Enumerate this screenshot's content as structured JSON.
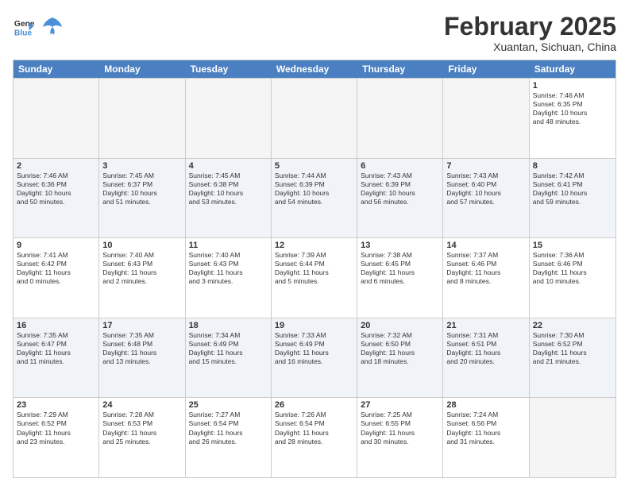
{
  "logo": {
    "line1": "General",
    "line2": "Blue"
  },
  "title": "February 2025",
  "subtitle": "Xuantan, Sichuan, China",
  "header_days": [
    "Sunday",
    "Monday",
    "Tuesday",
    "Wednesday",
    "Thursday",
    "Friday",
    "Saturday"
  ],
  "weeks": [
    {
      "alt": false,
      "cells": [
        {
          "day": "",
          "info": "",
          "empty": true
        },
        {
          "day": "",
          "info": "",
          "empty": true
        },
        {
          "day": "",
          "info": "",
          "empty": true
        },
        {
          "day": "",
          "info": "",
          "empty": true
        },
        {
          "day": "",
          "info": "",
          "empty": true
        },
        {
          "day": "",
          "info": "",
          "empty": true
        },
        {
          "day": "1",
          "info": "Sunrise: 7:46 AM\nSunset: 6:35 PM\nDaylight: 10 hours\nand 48 minutes.",
          "empty": false
        }
      ]
    },
    {
      "alt": true,
      "cells": [
        {
          "day": "2",
          "info": "Sunrise: 7:46 AM\nSunset: 6:36 PM\nDaylight: 10 hours\nand 50 minutes.",
          "empty": false
        },
        {
          "day": "3",
          "info": "Sunrise: 7:45 AM\nSunset: 6:37 PM\nDaylight: 10 hours\nand 51 minutes.",
          "empty": false
        },
        {
          "day": "4",
          "info": "Sunrise: 7:45 AM\nSunset: 6:38 PM\nDaylight: 10 hours\nand 53 minutes.",
          "empty": false
        },
        {
          "day": "5",
          "info": "Sunrise: 7:44 AM\nSunset: 6:39 PM\nDaylight: 10 hours\nand 54 minutes.",
          "empty": false
        },
        {
          "day": "6",
          "info": "Sunrise: 7:43 AM\nSunset: 6:39 PM\nDaylight: 10 hours\nand 56 minutes.",
          "empty": false
        },
        {
          "day": "7",
          "info": "Sunrise: 7:43 AM\nSunset: 6:40 PM\nDaylight: 10 hours\nand 57 minutes.",
          "empty": false
        },
        {
          "day": "8",
          "info": "Sunrise: 7:42 AM\nSunset: 6:41 PM\nDaylight: 10 hours\nand 59 minutes.",
          "empty": false
        }
      ]
    },
    {
      "alt": false,
      "cells": [
        {
          "day": "9",
          "info": "Sunrise: 7:41 AM\nSunset: 6:42 PM\nDaylight: 11 hours\nand 0 minutes.",
          "empty": false
        },
        {
          "day": "10",
          "info": "Sunrise: 7:40 AM\nSunset: 6:43 PM\nDaylight: 11 hours\nand 2 minutes.",
          "empty": false
        },
        {
          "day": "11",
          "info": "Sunrise: 7:40 AM\nSunset: 6:43 PM\nDaylight: 11 hours\nand 3 minutes.",
          "empty": false
        },
        {
          "day": "12",
          "info": "Sunrise: 7:39 AM\nSunset: 6:44 PM\nDaylight: 11 hours\nand 5 minutes.",
          "empty": false
        },
        {
          "day": "13",
          "info": "Sunrise: 7:38 AM\nSunset: 6:45 PM\nDaylight: 11 hours\nand 6 minutes.",
          "empty": false
        },
        {
          "day": "14",
          "info": "Sunrise: 7:37 AM\nSunset: 6:46 PM\nDaylight: 11 hours\nand 8 minutes.",
          "empty": false
        },
        {
          "day": "15",
          "info": "Sunrise: 7:36 AM\nSunset: 6:46 PM\nDaylight: 11 hours\nand 10 minutes.",
          "empty": false
        }
      ]
    },
    {
      "alt": true,
      "cells": [
        {
          "day": "16",
          "info": "Sunrise: 7:35 AM\nSunset: 6:47 PM\nDaylight: 11 hours\nand 11 minutes.",
          "empty": false
        },
        {
          "day": "17",
          "info": "Sunrise: 7:35 AM\nSunset: 6:48 PM\nDaylight: 11 hours\nand 13 minutes.",
          "empty": false
        },
        {
          "day": "18",
          "info": "Sunrise: 7:34 AM\nSunset: 6:49 PM\nDaylight: 11 hours\nand 15 minutes.",
          "empty": false
        },
        {
          "day": "19",
          "info": "Sunrise: 7:33 AM\nSunset: 6:49 PM\nDaylight: 11 hours\nand 16 minutes.",
          "empty": false
        },
        {
          "day": "20",
          "info": "Sunrise: 7:32 AM\nSunset: 6:50 PM\nDaylight: 11 hours\nand 18 minutes.",
          "empty": false
        },
        {
          "day": "21",
          "info": "Sunrise: 7:31 AM\nSunset: 6:51 PM\nDaylight: 11 hours\nand 20 minutes.",
          "empty": false
        },
        {
          "day": "22",
          "info": "Sunrise: 7:30 AM\nSunset: 6:52 PM\nDaylight: 11 hours\nand 21 minutes.",
          "empty": false
        }
      ]
    },
    {
      "alt": false,
      "cells": [
        {
          "day": "23",
          "info": "Sunrise: 7:29 AM\nSunset: 6:52 PM\nDaylight: 11 hours\nand 23 minutes.",
          "empty": false
        },
        {
          "day": "24",
          "info": "Sunrise: 7:28 AM\nSunset: 6:53 PM\nDaylight: 11 hours\nand 25 minutes.",
          "empty": false
        },
        {
          "day": "25",
          "info": "Sunrise: 7:27 AM\nSunset: 6:54 PM\nDaylight: 11 hours\nand 26 minutes.",
          "empty": false
        },
        {
          "day": "26",
          "info": "Sunrise: 7:26 AM\nSunset: 6:54 PM\nDaylight: 11 hours\nand 28 minutes.",
          "empty": false
        },
        {
          "day": "27",
          "info": "Sunrise: 7:25 AM\nSunset: 6:55 PM\nDaylight: 11 hours\nand 30 minutes.",
          "empty": false
        },
        {
          "day": "28",
          "info": "Sunrise: 7:24 AM\nSunset: 6:56 PM\nDaylight: 11 hours\nand 31 minutes.",
          "empty": false
        },
        {
          "day": "",
          "info": "",
          "empty": true
        }
      ]
    }
  ]
}
